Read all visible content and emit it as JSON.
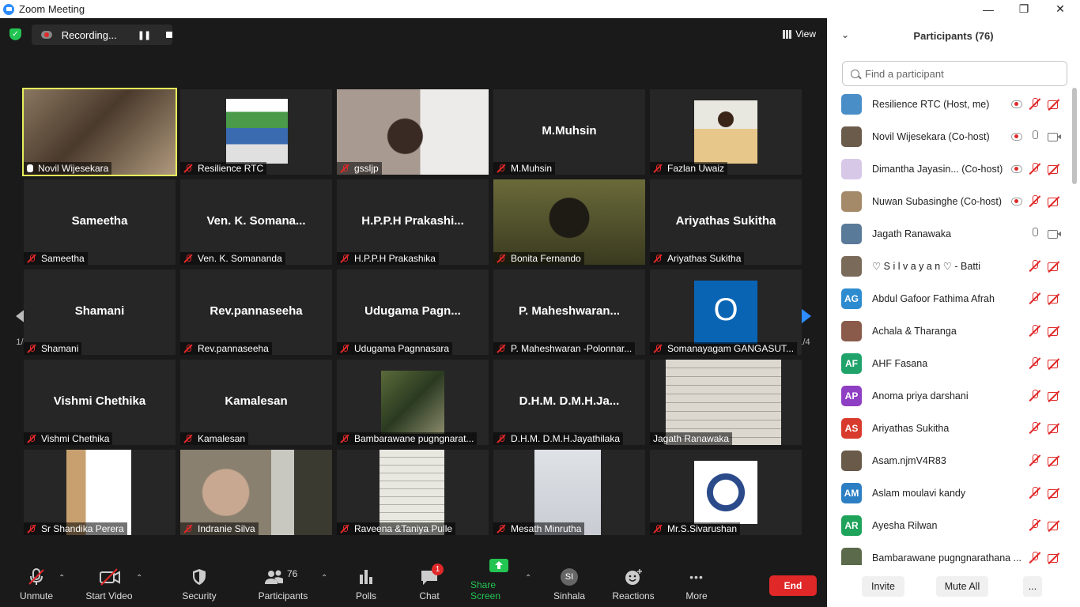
{
  "window": {
    "title": "Zoom Meeting",
    "min_glyph": "—",
    "max_glyph": "❐",
    "close_glyph": "✕"
  },
  "topbar": {
    "recording_label": "Recording...",
    "pause_glyph": "❚❚",
    "view_label": "View"
  },
  "gallery": {
    "page_indicator": "1/4",
    "tiles": [
      {
        "name": "Novil Wijesekara",
        "big": "",
        "video": true,
        "bg": "#7a6a58",
        "active": true,
        "muted": false
      },
      {
        "name": "Resilience RTC",
        "big": "",
        "video": true,
        "bg": "#262626",
        "active": false,
        "muted": true
      },
      {
        "name": "gssljp",
        "big": "",
        "video": true,
        "bg": "#9a8e86",
        "active": false,
        "muted": true
      },
      {
        "name": "M.Muhsin",
        "big": "M.Muhsin",
        "video": false,
        "bg": "#262626",
        "active": false,
        "muted": true
      },
      {
        "name": "Fazlan Uwaiz",
        "big": "",
        "video": true,
        "bg": "#262626",
        "active": false,
        "muted": true
      },
      {
        "name": "Sameetha",
        "big": "Sameetha",
        "video": false,
        "bg": "#262626",
        "active": false,
        "muted": true
      },
      {
        "name": "Ven. K. Somananda",
        "big": "Ven. K. Somana...",
        "video": false,
        "bg": "#262626",
        "active": false,
        "muted": true
      },
      {
        "name": "H.P.P.H Prakashika",
        "big": "H.P.P.H  Prakashi...",
        "video": false,
        "bg": "#262626",
        "active": false,
        "muted": true
      },
      {
        "name": "Bonita Fernando",
        "big": "",
        "video": true,
        "bg": "#5b5a2c",
        "active": false,
        "muted": true
      },
      {
        "name": "Ariyathas Sukitha",
        "big": "Ariyathas Sukitha",
        "video": false,
        "bg": "#262626",
        "active": false,
        "muted": true
      },
      {
        "name": "Shamani",
        "big": "Shamani",
        "video": false,
        "bg": "#262626",
        "active": false,
        "muted": true
      },
      {
        "name": "Rev.pannaseeha",
        "big": "Rev.pannaseeha",
        "video": false,
        "bg": "#262626",
        "active": false,
        "muted": true
      },
      {
        "name": "Udugama Pagnnasara",
        "big": "Udugama  Pagn...",
        "video": false,
        "bg": "#262626",
        "active": false,
        "muted": true
      },
      {
        "name": "P. Maheshwaran -Polonnar...",
        "big": "P.  Maheshwaran...",
        "video": false,
        "bg": "#262626",
        "active": false,
        "muted": true
      },
      {
        "name": "Somanayagam GANGASUT...",
        "big": "",
        "video": true,
        "bg": "#262626",
        "active": false,
        "muted": true
      },
      {
        "name": "Vishmi Chethika",
        "big": "Vishmi Chethika",
        "video": false,
        "bg": "#262626",
        "active": false,
        "muted": true
      },
      {
        "name": "Kamalesan",
        "big": "Kamalesan",
        "video": false,
        "bg": "#262626",
        "active": false,
        "muted": true
      },
      {
        "name": "Bambarawane pugngnarat...",
        "big": "",
        "video": true,
        "bg": "#262626",
        "active": false,
        "muted": true
      },
      {
        "name": "D.H.M. D.M.H.Jayathilaka",
        "big": "D.H.M.  D.M.H.Ja...",
        "video": false,
        "bg": "#262626",
        "active": false,
        "muted": true
      },
      {
        "name": "Jagath Ranawaka",
        "big": "",
        "video": true,
        "bg": "#262626",
        "active": false,
        "muted": false
      },
      {
        "name": "Sr Shandika Perera",
        "big": "",
        "video": true,
        "bg": "#262626",
        "active": false,
        "muted": true
      },
      {
        "name": "Indranie Silva",
        "big": "",
        "video": true,
        "bg": "#6e6a62",
        "active": false,
        "muted": true
      },
      {
        "name": "Raveena &Taniya Pulle",
        "big": "",
        "video": true,
        "bg": "#262626",
        "active": false,
        "muted": true
      },
      {
        "name": "Mesath Minrutha",
        "big": "",
        "video": true,
        "bg": "#262626",
        "active": false,
        "muted": true
      },
      {
        "name": "Mr.S.Sivarushan",
        "big": "",
        "video": true,
        "bg": "#262626",
        "active": false,
        "muted": true
      }
    ],
    "somanayagam_initial": "O"
  },
  "toolbar": {
    "unmute": "Unmute",
    "start_video": "Start Video",
    "security": "Security",
    "participants": "Participants",
    "participants_count": "76",
    "polls": "Polls",
    "chat": "Chat",
    "chat_badge": "1",
    "share_screen": "Share Screen",
    "sinhala": "Sinhala",
    "sinhala_initials": "SI",
    "reactions": "Reactions",
    "more": "More",
    "more_glyph": "•••",
    "end": "End",
    "caret_glyph": "⌃"
  },
  "panel": {
    "title": "Participants (76)",
    "collapse_glyph": "⌄",
    "search_placeholder": "Find a participant",
    "participants": [
      {
        "name": "Resilience RTC (Host, me)",
        "initials": "",
        "color": "#4a8ec8",
        "rec": true,
        "mic": "off",
        "cam": "off"
      },
      {
        "name": "Novil Wijesekara (Co-host)",
        "initials": "",
        "color": "#6b5b4a",
        "rec": true,
        "mic": "on",
        "cam": "on"
      },
      {
        "name": "Dimantha Jayasin... (Co-host)",
        "initials": "",
        "color": "#d8c8e8",
        "rec": true,
        "mic": "off",
        "cam": "off"
      },
      {
        "name": "Nuwan Subasinghe (Co-host)",
        "initials": "",
        "color": "#a58a6a",
        "rec": true,
        "mic": "off",
        "cam": "off"
      },
      {
        "name": "Jagath Ranawaka",
        "initials": "",
        "color": "#5a7a9a",
        "rec": false,
        "mic": "on",
        "cam": "on"
      },
      {
        "name": "♡ S i l v a y a n ♡ - Batti",
        "initials": "",
        "color": "#7a6a5a",
        "rec": false,
        "mic": "off",
        "cam": "off"
      },
      {
        "name": "Abdul Gafoor Fathima Afrah",
        "initials": "AG",
        "color": "#2d8cd0",
        "rec": false,
        "mic": "off",
        "cam": "off"
      },
      {
        "name": "Achala & Tharanga",
        "initials": "",
        "color": "#8a5a4a",
        "rec": false,
        "mic": "off",
        "cam": "off"
      },
      {
        "name": "AHF Fasana",
        "initials": "AF",
        "color": "#1fa36b",
        "rec": false,
        "mic": "off",
        "cam": "off"
      },
      {
        "name": "Anoma priya darshani",
        "initials": "AP",
        "color": "#8e3fc4",
        "rec": false,
        "mic": "off",
        "cam": "off"
      },
      {
        "name": "Ariyathas Sukitha",
        "initials": "AS",
        "color": "#d83a2e",
        "rec": false,
        "mic": "off",
        "cam": "off"
      },
      {
        "name": "Asam.njmV4R83",
        "initials": "",
        "color": "#6a5a4a",
        "rec": false,
        "mic": "off",
        "cam": "off"
      },
      {
        "name": "Aslam moulavi kandy",
        "initials": "AM",
        "color": "#2d7fc4",
        "rec": false,
        "mic": "off",
        "cam": "off"
      },
      {
        "name": "Ayesha Rilwan",
        "initials": "AR",
        "color": "#1fa35a",
        "rec": false,
        "mic": "off",
        "cam": "off"
      },
      {
        "name": "Bambarawane pugngnarathana ...",
        "initials": "",
        "color": "#5a6a4a",
        "rec": false,
        "mic": "off",
        "cam": "off"
      }
    ],
    "invite": "Invite",
    "mute_all": "Mute All",
    "more": "..."
  }
}
